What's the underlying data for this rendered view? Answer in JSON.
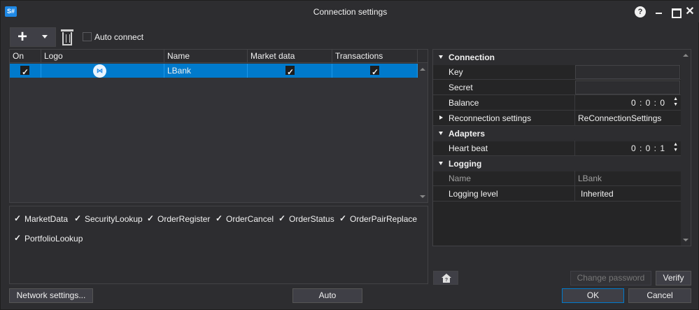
{
  "window": {
    "title": "Connection settings",
    "app_icon": "S#"
  },
  "toolbar": {
    "auto_connect_label": "Auto connect",
    "auto_connect_checked": false
  },
  "grid": {
    "columns": [
      "On",
      "Logo",
      "Name",
      "Market data",
      "Transactions"
    ],
    "rows": [
      {
        "on": true,
        "logo": "LBank-logo",
        "name": "LBank",
        "market_data": true,
        "transactions": true
      }
    ]
  },
  "messages": [
    {
      "label": "MarketData",
      "checked": true
    },
    {
      "label": "SecurityLookup",
      "checked": true
    },
    {
      "label": "OrderRegister",
      "checked": true
    },
    {
      "label": "OrderCancel",
      "checked": true
    },
    {
      "label": "OrderStatus",
      "checked": true
    },
    {
      "label": "OrderPairReplace",
      "checked": true
    },
    {
      "label": "PortfolioLookup",
      "checked": true
    }
  ],
  "properties": {
    "connection_category": "Connection",
    "key_label": "Key",
    "key_value": "",
    "secret_label": "Secret",
    "secret_value": "",
    "balance_label": "Balance",
    "balance_value": "0 : 0 : 0",
    "reconnection_label": "Reconnection settings",
    "reconnection_value": "ReConnectionSettings",
    "adapters_category": "Adapters",
    "heartbeat_label": "Heart beat",
    "heartbeat_value": "0 : 0 : 1",
    "logging_category": "Logging",
    "name_label": "Name",
    "name_value": "LBank",
    "logging_level_label": "Logging level",
    "logging_level_value": "Inherited"
  },
  "buttons": {
    "change_password": "Change password",
    "verify": "Verify",
    "network_settings": "Network settings...",
    "auto": "Auto",
    "ok": "OK",
    "cancel": "Cancel"
  },
  "colors": {
    "accent": "#007acc",
    "background": "#2d2d30"
  }
}
